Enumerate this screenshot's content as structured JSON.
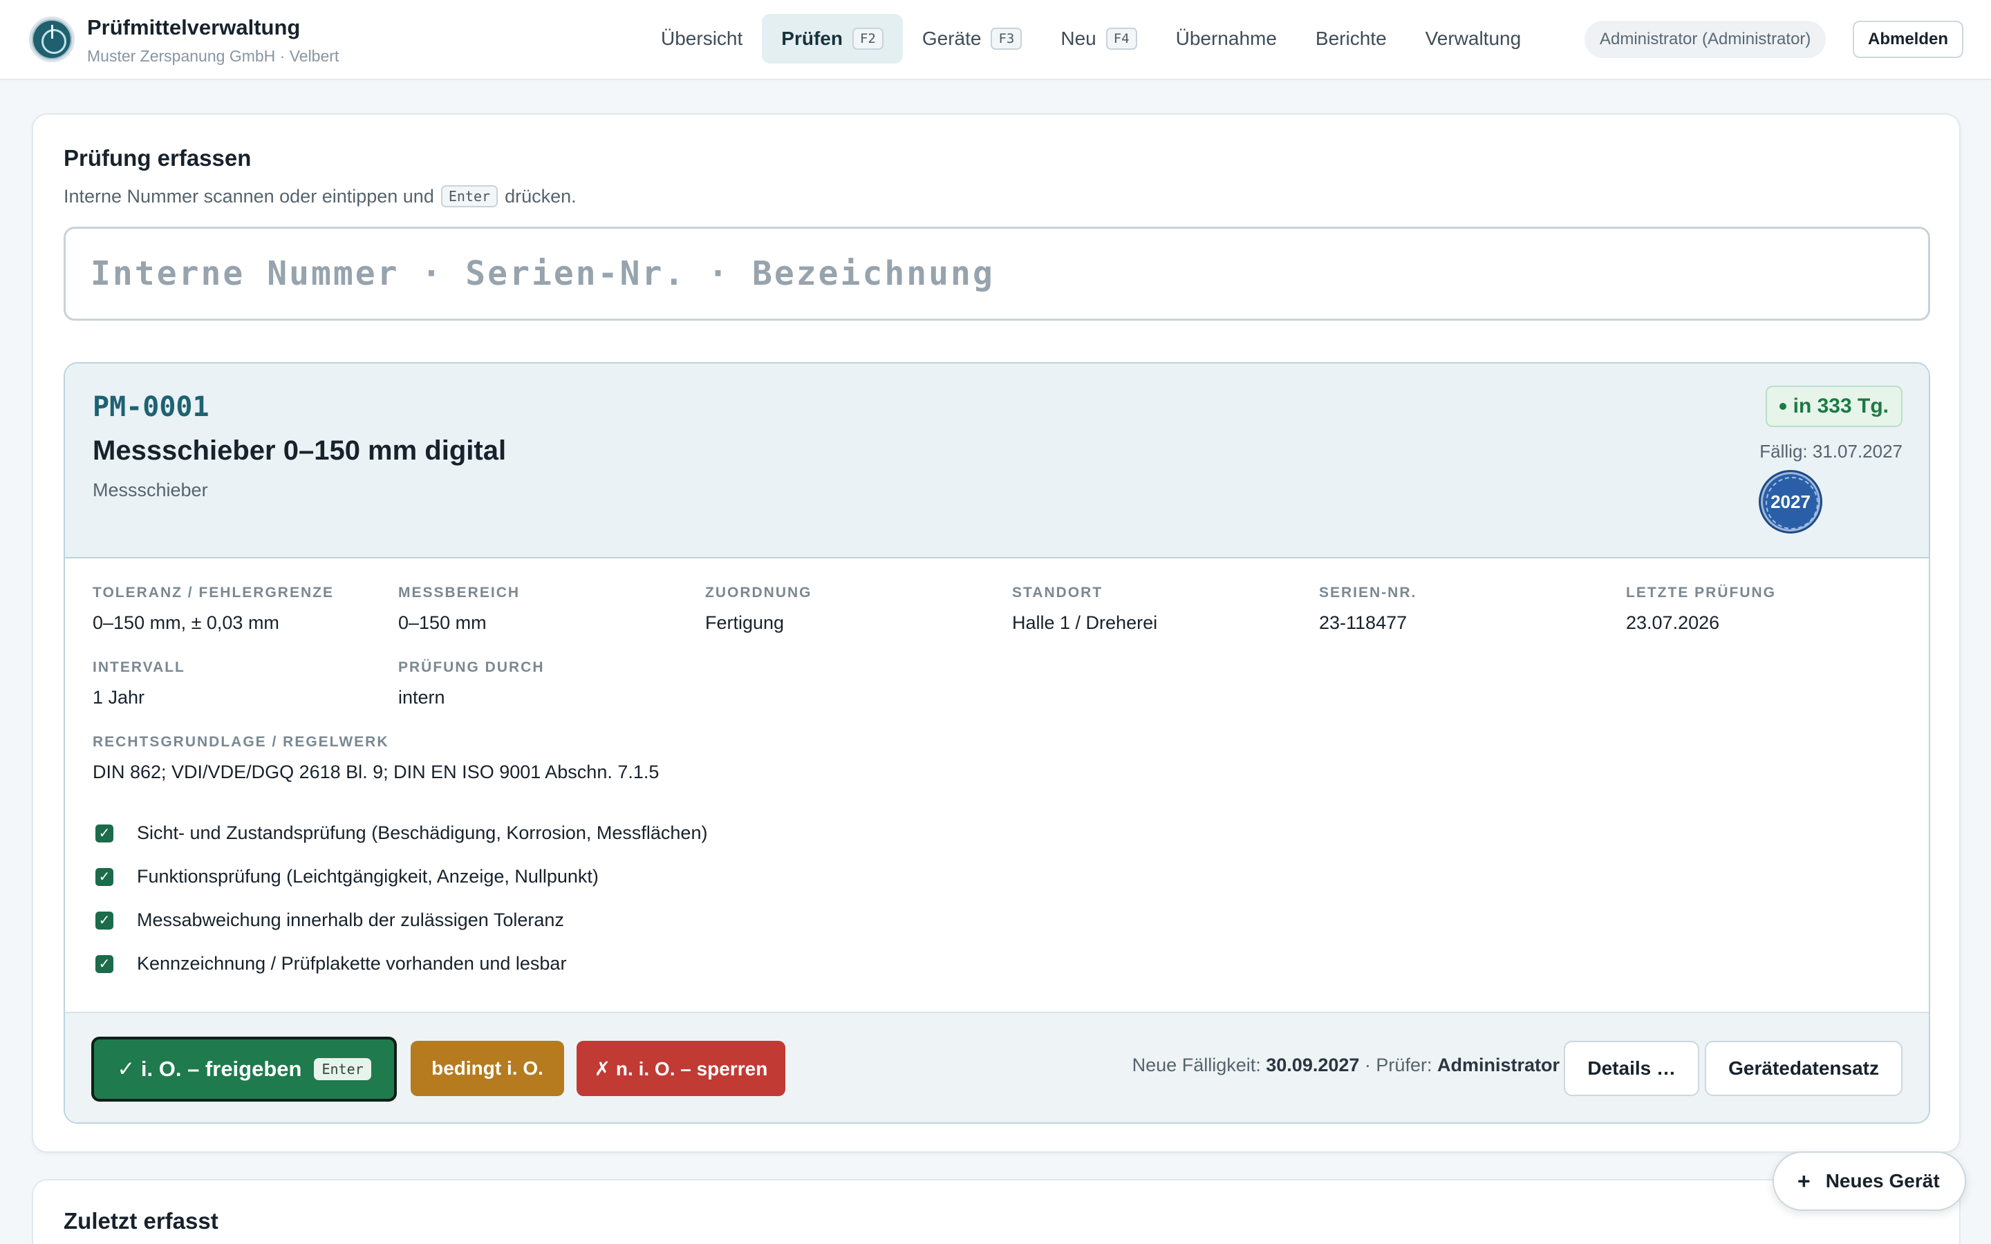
{
  "app": {
    "title": "Prüfmittelverwaltung",
    "subtitle": "Muster Zerspanung GmbH · Velbert"
  },
  "nav": [
    {
      "label": "Übersicht",
      "key": ""
    },
    {
      "label": "Prüfen",
      "key": "F2",
      "active": true
    },
    {
      "label": "Geräte",
      "key": "F3"
    },
    {
      "label": "Neu",
      "key": "F4"
    },
    {
      "label": "Übernahme",
      "key": ""
    },
    {
      "label": "Berichte",
      "key": ""
    },
    {
      "label": "Verwaltung",
      "key": ""
    }
  ],
  "user": {
    "name": "Administrator (Administrator)",
    "logout_label": "Abmelden"
  },
  "capture": {
    "title": "Prüfung erfassen",
    "hint_before": "Interne Nummer scannen oder eintippen und",
    "hint_key": "Enter",
    "hint_after": "drücken.",
    "search_placeholder": "Interne Nummer · Serien-Nr. · Bezeichnung",
    "search_value": ""
  },
  "device": {
    "id": "PM-0001",
    "name": "Messschieber 0–150 mm digital",
    "category": "Messschieber",
    "due_badge": "in 333 Tg.",
    "due_date": "Fällig: 31.07.2027",
    "seal_year": "2027",
    "fields": [
      {
        "label": "TOLERANZ / FEHLERGRENZE",
        "value": "0–150 mm, ± 0,03 mm"
      },
      {
        "label": "MESSBEREICH",
        "value": "0–150 mm"
      },
      {
        "label": "ZUORDNUNG",
        "value": "Fertigung"
      },
      {
        "label": "STANDORT",
        "value": "Halle 1 / Dreherei"
      },
      {
        "label": "SERIEN-NR.",
        "value": "23-118477"
      },
      {
        "label": "LETZTE PRÜFUNG",
        "value": "23.07.2026"
      },
      {
        "label": "INTERVALL",
        "value": "1 Jahr"
      },
      {
        "label": "PRÜFUNG DURCH",
        "value": "intern"
      },
      {
        "label": "RECHTSGRUNDLAGE / REGELWERK",
        "value": "DIN 862; VDI/VDE/DGQ 2618 Bl. 9; DIN EN ISO 9001 Abschn. 7.1.5"
      }
    ],
    "checks": [
      {
        "label": "Sicht- und Zustandsprüfung (Beschädigung, Korrosion, Messflächen)",
        "checked": true
      },
      {
        "label": "Funktionsprüfung (Leichtgängigkeit, Anzeige, Nullpunkt)",
        "checked": true
      },
      {
        "label": "Messabweichung innerhalb der zulässigen Toleranz",
        "checked": true
      },
      {
        "label": "Kennzeichnung / Prüfplakette vorhanden und lesbar",
        "checked": true
      }
    ]
  },
  "actions": {
    "ok_label": "✓ i. O. – freigeben",
    "ok_key": "Enter",
    "conditional_label": "bedingt i. O.",
    "fail_label": "✗ n. i. O. – sperren",
    "new_due_label": "Neue Fälligkeit:",
    "new_due_value": "30.09.2027",
    "inspector_label": "Prüfer:",
    "inspector_value": "Administrator",
    "details_label": "Details …",
    "record_label": "Gerätedatensatz"
  },
  "recent": {
    "title": "Zuletzt erfasst"
  },
  "fab": {
    "plus": "+",
    "label": "Neues Gerät"
  },
  "colors": {
    "accent": "#1f6272",
    "ok": "#1f7a4d",
    "conditional": "#b57b1e",
    "fail": "#c23a34",
    "due_ok": "#1c7a43",
    "seal": "#2a5fa8"
  }
}
